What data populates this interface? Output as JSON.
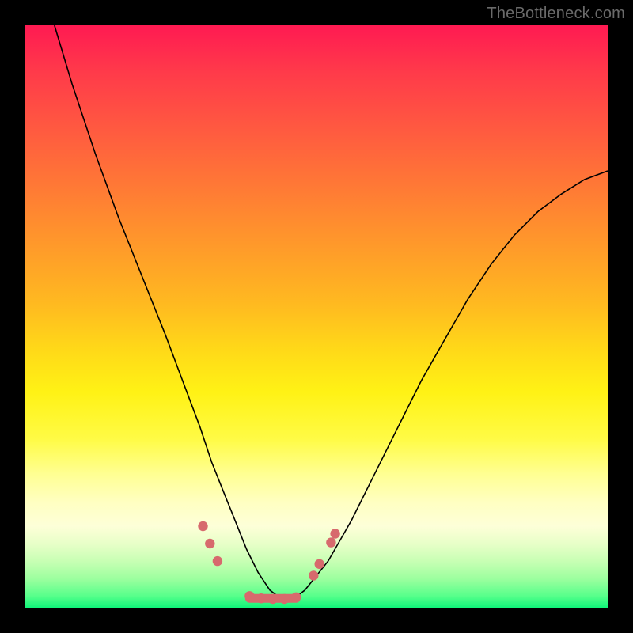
{
  "watermark": "TheBottleneck.com",
  "chart_data": {
    "type": "line",
    "title": "",
    "xlabel": "",
    "ylabel": "",
    "xlim": [
      0,
      100
    ],
    "ylim": [
      0,
      100
    ],
    "grid": false,
    "legend": null,
    "series": [
      {
        "name": "bottleneck-curve",
        "x": [
          5,
          8,
          12,
          16,
          20,
          24,
          27,
          30,
          32,
          34,
          36,
          38,
          40,
          42,
          44,
          46,
          48,
          52,
          56,
          60,
          64,
          68,
          72,
          76,
          80,
          84,
          88,
          92,
          96,
          100
        ],
        "y": [
          100,
          90,
          78,
          67,
          57,
          47,
          39,
          31,
          25,
          20,
          15,
          10,
          6,
          3,
          1.5,
          1.5,
          3,
          8,
          15,
          23,
          31,
          39,
          46,
          53,
          59,
          64,
          68,
          71,
          73.5,
          75
        ]
      }
    ],
    "markers": {
      "name": "highlight-dots",
      "color": "#d76a6d",
      "points": [
        {
          "x": 30.5,
          "y": 14
        },
        {
          "x": 31.7,
          "y": 11
        },
        {
          "x": 33.0,
          "y": 8
        },
        {
          "x": 38.5,
          "y": 2
        },
        {
          "x": 40.5,
          "y": 1.6
        },
        {
          "x": 42.5,
          "y": 1.5
        },
        {
          "x": 44.5,
          "y": 1.5
        },
        {
          "x": 46.5,
          "y": 1.8
        },
        {
          "x": 49.5,
          "y": 5.5
        },
        {
          "x": 50.5,
          "y": 7.5
        },
        {
          "x": 52.5,
          "y": 11.2
        },
        {
          "x": 53.2,
          "y": 12.7
        }
      ]
    },
    "segment": {
      "x0": 38.5,
      "x1": 46.5,
      "y": 1.6
    }
  }
}
